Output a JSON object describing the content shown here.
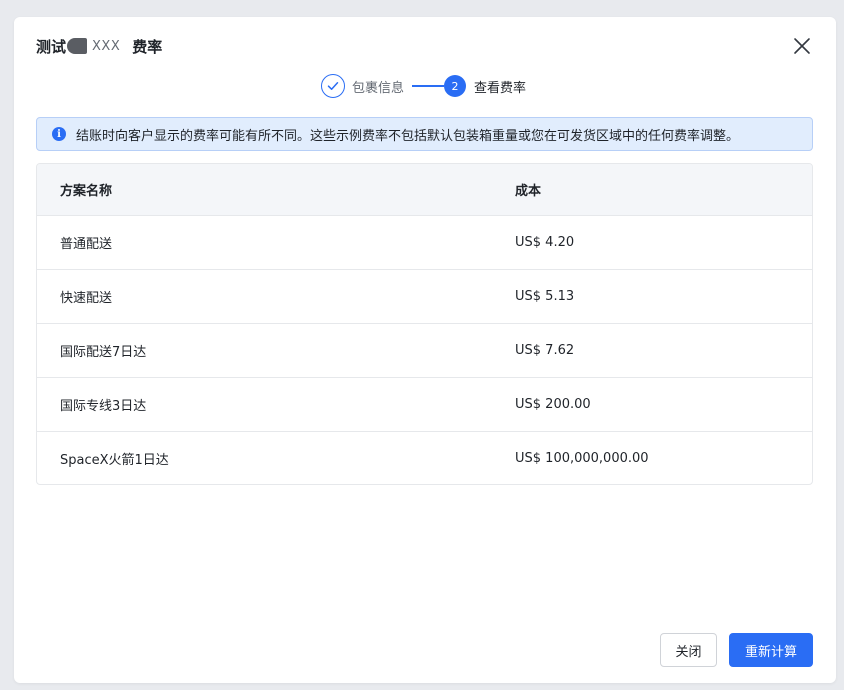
{
  "dialog": {
    "title_prefix": "测试",
    "title_name": "XXX",
    "title_suffix": "费率"
  },
  "steps": [
    {
      "label": "包裹信息",
      "state": "done"
    },
    {
      "number": "2",
      "label": "查看费率",
      "state": "active"
    }
  ],
  "notice": {
    "icon": "info-icon",
    "text": "结账时向客户显示的费率可能有所不同。这些示例费率不包括默认包装箱重量或您在可发货区域中的任何费率调整。"
  },
  "table": {
    "headers": {
      "name": "方案名称",
      "cost": "成本"
    },
    "rows": [
      {
        "name": "普通配送",
        "cost": "US$ 4.20"
      },
      {
        "name": "快速配送",
        "cost": "US$ 5.13"
      },
      {
        "name": "国际配送7日达",
        "cost": "US$ 7.62"
      },
      {
        "name": "国际专线3日达",
        "cost": "US$ 200.00"
      },
      {
        "name": "SpaceX火箭1日达",
        "cost": "US$ 100,000,000.00"
      }
    ]
  },
  "footer": {
    "close_label": "关闭",
    "recalc_label": "重新计算"
  },
  "colors": {
    "accent": "#2a6df4",
    "notice_bg": "#e1edfd"
  }
}
